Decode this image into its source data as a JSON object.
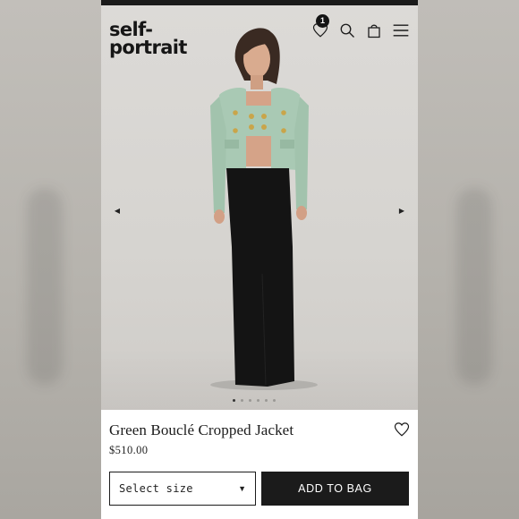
{
  "brand": {
    "logo_line1": "self-",
    "logo_line2": "portrait"
  },
  "header": {
    "wishlist_count": "1"
  },
  "product": {
    "name": "Green Bouclé Cropped Jacket",
    "price": "$510.00",
    "size_select_label": "Select size",
    "add_to_bag_label": "ADD TO BAG"
  },
  "gallery": {
    "total_images": 6,
    "active_index": 0
  },
  "icons": [
    "heart-icon",
    "search-icon",
    "bag-icon",
    "menu-icon",
    "arrow-left-icon",
    "arrow-right-icon",
    "caret-down-icon"
  ],
  "colors": {
    "jacket": "#a9c9b4",
    "skirt": "#141414",
    "accent": "#1b1b1b"
  }
}
